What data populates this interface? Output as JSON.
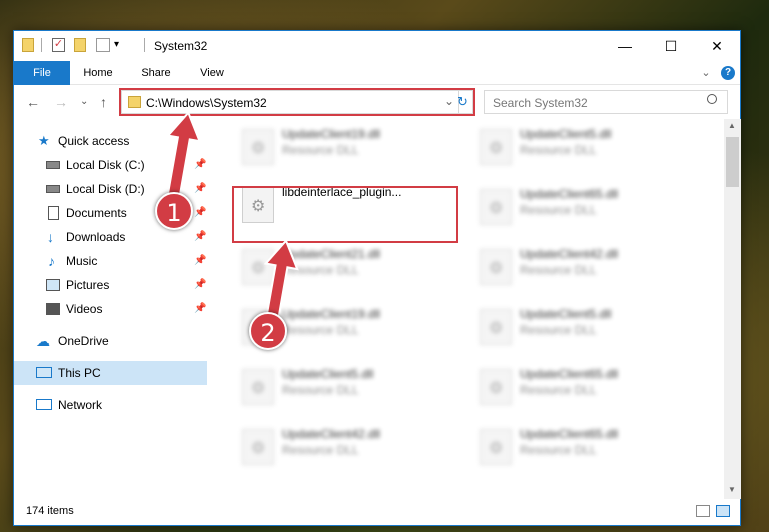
{
  "window": {
    "title": "System32",
    "min": "—",
    "max": "☐",
    "close": "✕"
  },
  "ribbon": {
    "tabs": [
      {
        "label": "File"
      },
      {
        "label": "Home"
      },
      {
        "label": "Share"
      },
      {
        "label": "View"
      }
    ],
    "expand": "⌄",
    "help": "?"
  },
  "address": {
    "path": "C:\\Windows\\System32",
    "dropdown": "⌄",
    "refresh": "↻"
  },
  "search": {
    "placeholder": "Search System32"
  },
  "nav_glyphs": {
    "back": "←",
    "forward": "→",
    "recent": "⌄",
    "up": "↑"
  },
  "sidebar": {
    "items": [
      {
        "label": "Quick access",
        "icon": "star-icon"
      },
      {
        "label": "Local Disk (C:)",
        "icon": "drive-icon",
        "pinned": true
      },
      {
        "label": "Local Disk (D:)",
        "icon": "drive-icon",
        "pinned": true
      },
      {
        "label": "Documents",
        "icon": "documents-icon",
        "pinned": true
      },
      {
        "label": "Downloads",
        "icon": "download-icon",
        "pinned": true
      },
      {
        "label": "Music",
        "icon": "music-icon",
        "pinned": true
      },
      {
        "label": "Pictures",
        "icon": "pictures-icon",
        "pinned": true
      },
      {
        "label": "Videos",
        "icon": "videos-icon",
        "pinned": true
      },
      {
        "label": "OneDrive",
        "icon": "cloud-icon"
      },
      {
        "label": "This PC",
        "icon": "computer-icon",
        "active": true
      },
      {
        "label": "Network",
        "icon": "network-icon"
      }
    ],
    "pin_glyph": "📌"
  },
  "files": {
    "left": [
      {
        "name": "UpdateClient19.dll",
        "type": "Resource DLL"
      },
      {
        "name": "libdeinterlace_plugin...",
        "type": ""
      },
      {
        "name": "UpdateClient21.dll",
        "type": "Resource DLL"
      },
      {
        "name": "UpdateClient19.dll",
        "type": "Resource DLL"
      },
      {
        "name": "UpdateClient5.dll",
        "type": "Resource DLL"
      },
      {
        "name": "UpdateClient42.dll",
        "type": "Resource DLL"
      }
    ],
    "right": [
      {
        "name": "UpdateClient5.dll",
        "type": "Resource DLL"
      },
      {
        "name": "UpdateClient65.dll",
        "type": "Resource DLL"
      },
      {
        "name": "UpdateClient42.dll",
        "type": "Resource DLL"
      },
      {
        "name": "UpdateClient5.dll",
        "type": "Resource DLL"
      },
      {
        "name": "UpdateClient65.dll",
        "type": "Resource DLL"
      },
      {
        "name": "UpdateClient65.dll",
        "type": "Resource DLL"
      }
    ]
  },
  "status": {
    "count": "174 items"
  },
  "annotations": {
    "step1": "1",
    "step2": "2",
    "color": "#d23c44"
  }
}
